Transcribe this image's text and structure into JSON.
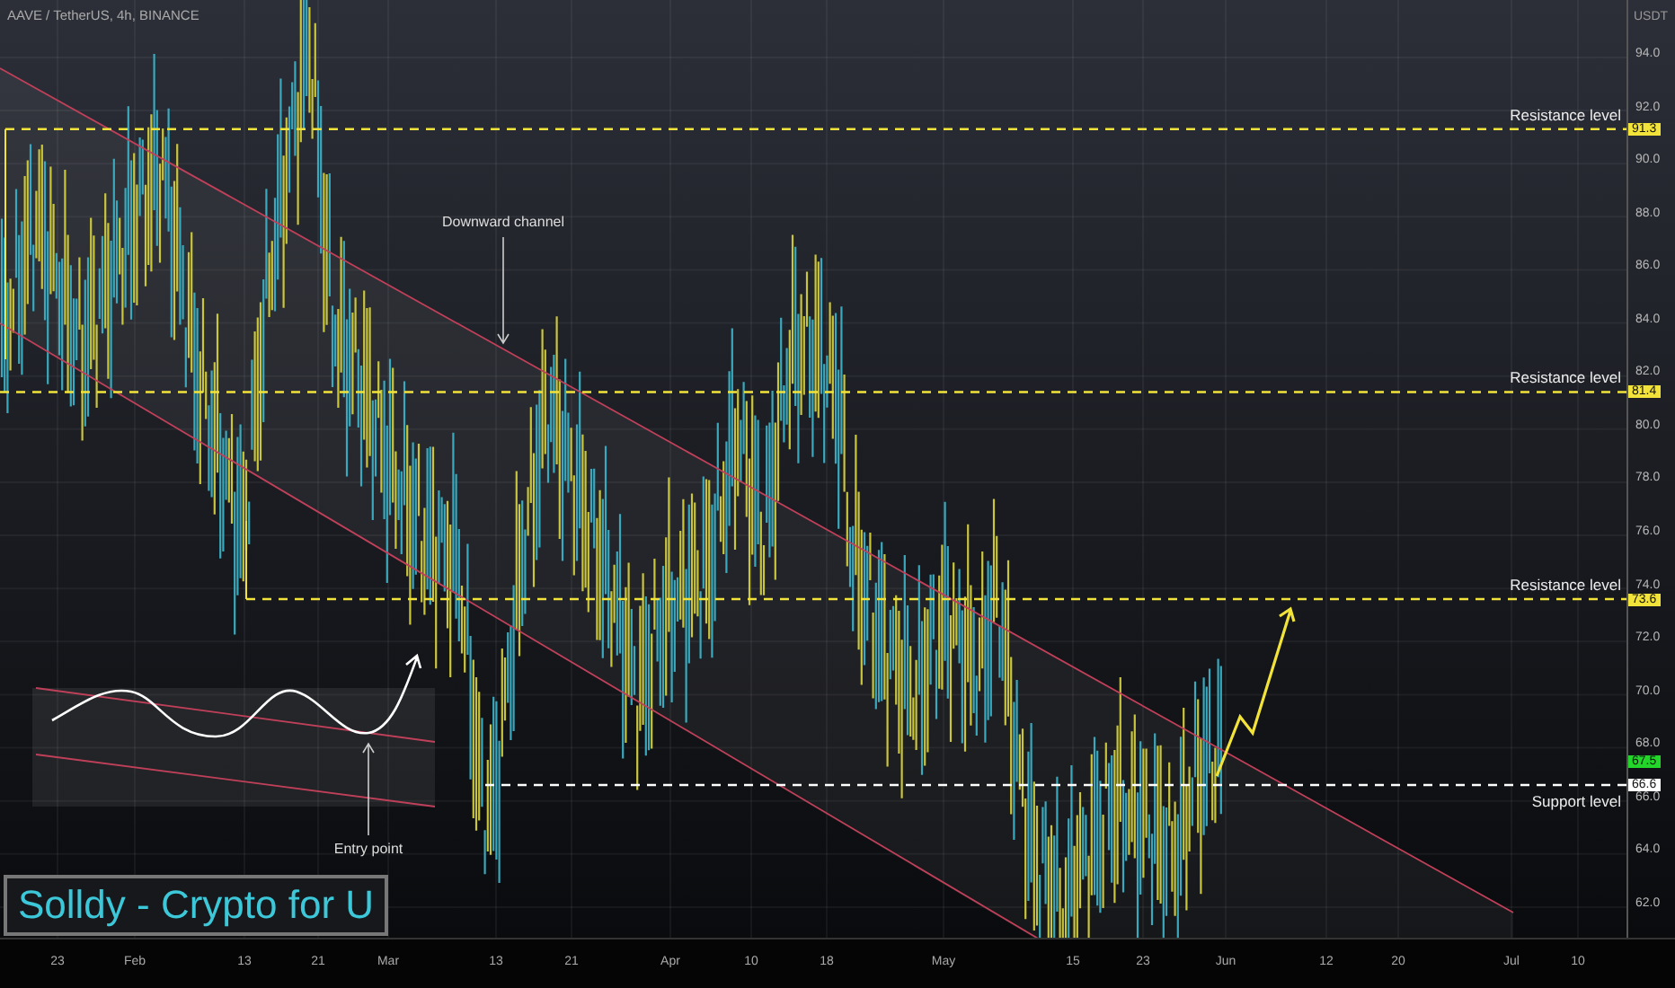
{
  "chart": {
    "title": "AAVE / TetherUS, 4h, BINANCE",
    "annotations": [
      {
        "kind": "channel",
        "text": "Downward channel"
      },
      {
        "kind": "entry",
        "text": "Entry point"
      }
    ],
    "levels": [
      {
        "label": "Resistance level",
        "price": "91.3",
        "color": "#f2e33a"
      },
      {
        "label": "Resistance level",
        "price": "81.4",
        "color": "#f2e33a"
      },
      {
        "label": "Resistance level",
        "price": "73.6",
        "color": "#f2e33a"
      },
      {
        "label": "Support level",
        "price": "66.6",
        "color": "#ffffff"
      }
    ],
    "current_price": "67.5",
    "price_axis": {
      "unit": "USDT",
      "ticks": [
        "94.0",
        "92.0",
        "90.0",
        "88.0",
        "86.0",
        "84.0",
        "82.0",
        "80.0",
        "78.0",
        "76.0",
        "74.0",
        "72.0",
        "70.0",
        "68.0",
        "66.0",
        "64.0",
        "62.0"
      ]
    },
    "time_axis": {
      "ticks": [
        "23",
        "Feb",
        "13",
        "21",
        "Mar",
        "13",
        "21",
        "Apr",
        "10",
        "18",
        "May",
        "15",
        "23",
        "Jun",
        "12",
        "20",
        "Jul",
        "10"
      ]
    },
    "branding": "Solldy - Crypto for U"
  }
}
